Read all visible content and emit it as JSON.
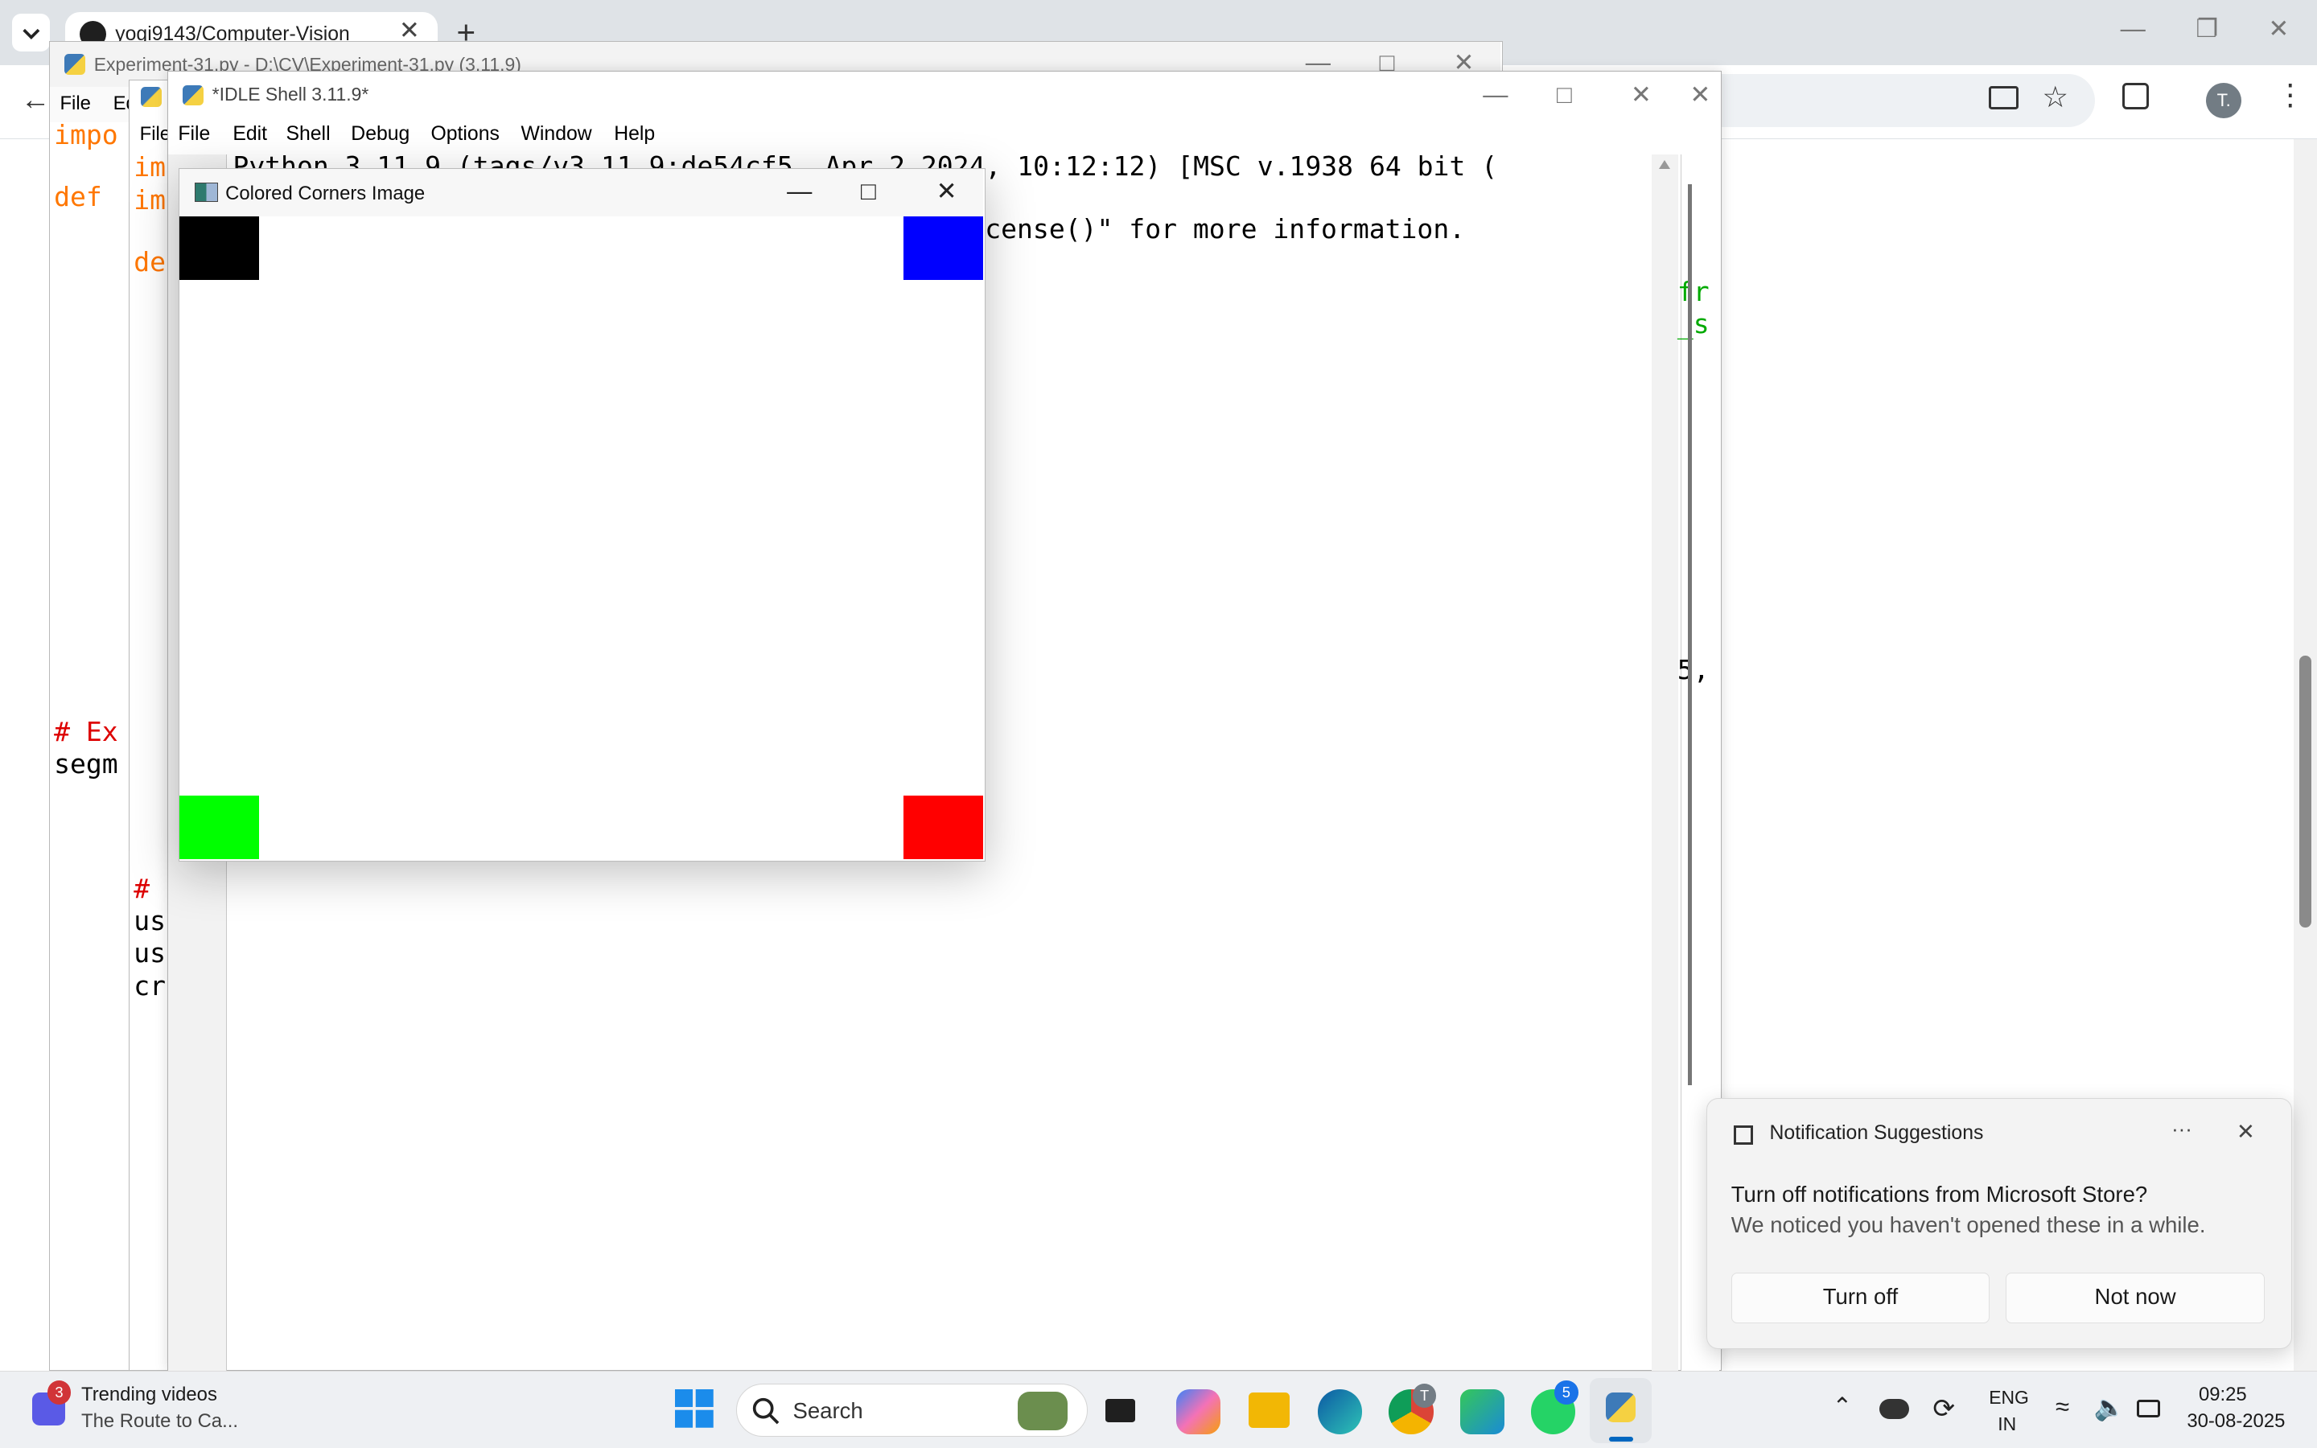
{
  "browser": {
    "tab_title": "yogi9143/Computer-Vision",
    "new_tab_symbol": "+",
    "close_symbol": "✕",
    "avatar_initial": "T."
  },
  "editor": {
    "title": "Experiment-31.py - D:\\CV\\Experiment-31.py (3.11.9)",
    "menu": {
      "file": "File",
      "edit": "Ed"
    },
    "code_lines": [
      {
        "text": "impo",
        "color": "#ff7700"
      },
      {
        "text": "def",
        "color": "#ff7700"
      },
      {
        "text": "# Ex",
        "color": "#dd0000"
      },
      {
        "text": "segm",
        "color": "#000000"
      }
    ]
  },
  "middle": {
    "menu_file": "File",
    "code_lines": [
      {
        "text": "im",
        "color": "#ff7700"
      },
      {
        "text": "im",
        "color": "#ff7700"
      },
      {
        "text": "de",
        "color": "#ff7700"
      },
      {
        "text": "#",
        "color": "#dd0000"
      },
      {
        "text": "us",
        "color": "#000000"
      },
      {
        "text": "us",
        "color": "#000000"
      },
      {
        "text": "cr",
        "color": "#000000"
      }
    ]
  },
  "shell": {
    "title": "*IDLE Shell 3.11.9*",
    "menu": [
      "File",
      "Edit",
      "Shell",
      "Debug",
      "Options",
      "Window",
      "Help"
    ],
    "line1": "Python 3.11.9 (tags/v3.11.9:de54cf5, Apr  2 2024, 10:12:12) [MSC v.1938 64 bit (",
    "line2": "cense()\" for more information.",
    "right_frag1": "fr",
    "right_frag2": "_s",
    "right_frag3": "5,"
  },
  "image_window": {
    "title": "Colored Corners Image",
    "corners": {
      "top_left": "#000000",
      "top_right": "#0000ff",
      "bottom_left": "#00ff00",
      "bottom_right": "#ff0000"
    }
  },
  "notification": {
    "header": "Notification Suggestions",
    "more": "···",
    "close": "✕",
    "title": "Turn off notifications from Microsoft Store?",
    "body": "We noticed you haven't opened these in a while.",
    "btn_primary": "Turn off",
    "btn_secondary": "Not now"
  },
  "taskbar": {
    "widget_title": "Trending videos",
    "widget_sub": "The Route to Ca...",
    "widget_badge": "3",
    "search_label": "Search",
    "chrome_badge": "T",
    "whatsapp_badge": "5",
    "lang_top": "ENG",
    "lang_bottom": "IN",
    "time": "09:25",
    "date": "30-08-2025"
  }
}
